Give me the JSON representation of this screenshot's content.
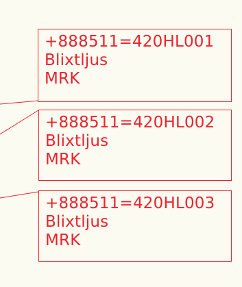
{
  "theme": {
    "background": "#FCFBF1",
    "accent": "#E8232E"
  },
  "labels": [
    {
      "tag": "+888511=420HL001",
      "name": "Blixtljus",
      "code": "MRK"
    },
    {
      "tag": "+888511=420HL002",
      "name": "Blixtljus",
      "code": "MRK"
    },
    {
      "tag": "+888511=420HL003",
      "name": "Blixtljus",
      "code": "MRK"
    }
  ]
}
